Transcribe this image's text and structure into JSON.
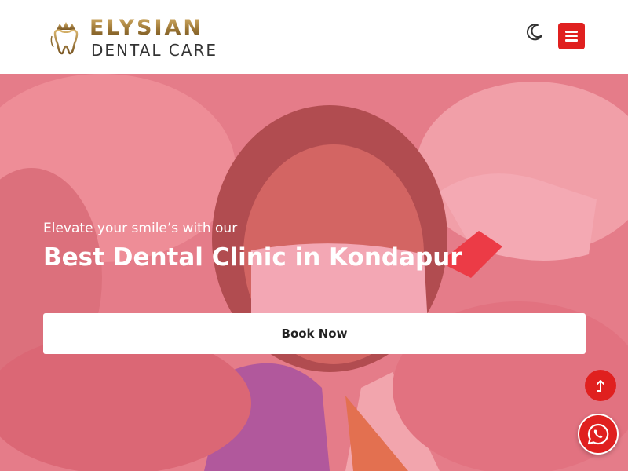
{
  "header": {
    "logo": {
      "brand": "ELYSIAN",
      "tagline": "DENTAL CARE"
    },
    "theme_toggle_icon": "moon-icon",
    "menu_icon": "hamburger-menu-icon"
  },
  "hero": {
    "pre_title": "Elevate your smile’s with our",
    "title": "Best Dental Clinic in Kondapur",
    "cta_label": "Book Now",
    "overlay_color": "#f55069"
  },
  "floating": {
    "scroll_top_icon": "arrow-up-icon",
    "whatsapp_icon": "whatsapp-icon"
  },
  "colors": {
    "accent": "#e0201f",
    "logo_gold": "#9a7433"
  }
}
